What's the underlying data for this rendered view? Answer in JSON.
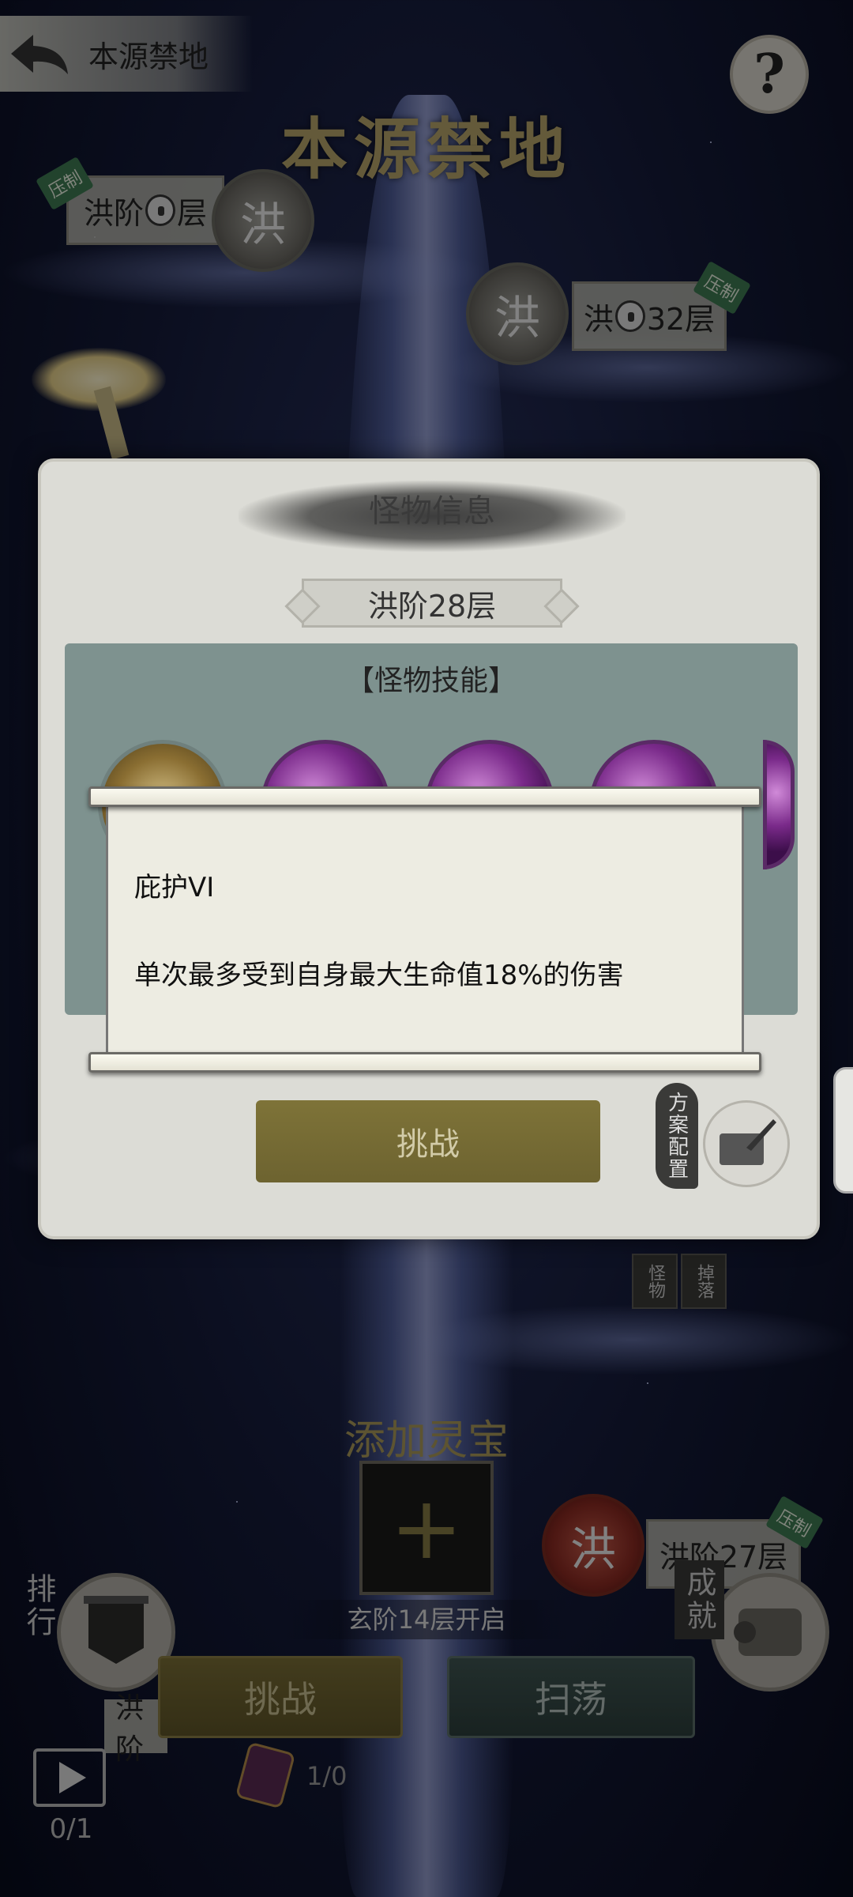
{
  "header": {
    "back_label": "本源禁地",
    "help_symbol": "?",
    "title": "本源禁地"
  },
  "map": {
    "nodes": [
      {
        "label_prefix": "洪阶",
        "label_suffix": "层",
        "locked": true,
        "tag": "压制"
      },
      {
        "label_prefix": "洪",
        "label_suffix": "32层",
        "locked": true,
        "tag": "压制"
      },
      {
        "label": "洪阶27层",
        "tag": "压制"
      },
      {
        "label": "洪阶"
      }
    ],
    "medal_glyph": "洪",
    "side_tags": [
      "怪物",
      "掉落"
    ]
  },
  "dialog": {
    "title": "怪物信息",
    "floor": "洪阶28层",
    "skills_title": "【怪物技能】",
    "challenge_label": "挑战",
    "plan_label": "方案配置"
  },
  "tooltip": {
    "name": "庇护VI",
    "description": "单次最多受到自身最大生命值18%的伤害"
  },
  "bottom": {
    "add_title": "添加灵宝",
    "add_symbol": "+",
    "unlock_text": "玄阶14层开启",
    "challenge_label": "挑战",
    "sweep_label": "扫荡",
    "ranking_label": "排行",
    "achievement_label": "成就",
    "video_count": "0/1",
    "ticket_count": "1/0"
  }
}
